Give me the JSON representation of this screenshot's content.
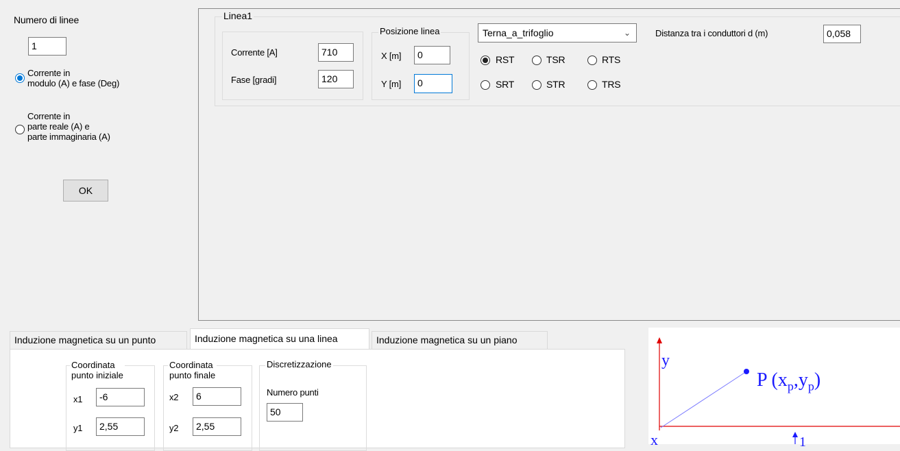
{
  "left_panel": {
    "num_lines_label": "Numero di linee",
    "num_lines_value": "1",
    "option_polar_label_1": "Corrente in",
    "option_polar_label_2": "modulo (A) e fase (Deg)",
    "option_rect_label_1": "Corrente in",
    "option_rect_label_2": "parte reale (A) e",
    "option_rect_label_3": "parte immaginaria (A)",
    "ok_label": "OK"
  },
  "line_group": {
    "title": "Linea1",
    "current_label": "Corrente [A]",
    "current_value": "710",
    "phase_label": "Fase [gradi]",
    "phase_value": "120",
    "position_title": "Posizione linea",
    "x_label": "X [m]",
    "x_value": "0",
    "y_label": "Y [m]",
    "y_value": "0",
    "configuration_selected": "Terna_a_trifoglio",
    "sequence_options": [
      "RST",
      "TSR",
      "RTS",
      "SRT",
      "STR",
      "TRS"
    ],
    "sequence_selected": "RST",
    "distance_label": "Distanza tra i conduttori d (m)",
    "distance_value": "0,058"
  },
  "tabs": [
    {
      "label": "Induzione magnetica su un punto",
      "active": false
    },
    {
      "label": "Induzione magnetica su una linea",
      "active": true
    },
    {
      "label": "Induzione magnetica su un piano",
      "active": false
    }
  ],
  "tab_content": {
    "start_title_1": "Coordinata",
    "start_title_2": "punto iniziale",
    "x1_label": "x1",
    "x1_value": "-6",
    "y1_label": "y1",
    "y1_value": "2,55",
    "end_title_1": "Coordinata",
    "end_title_2": "punto finale",
    "x2_label": "x2",
    "x2_value": "6",
    "y2_label": "y2",
    "y2_value": "2,55",
    "discretization_title": "Discretizzazione",
    "num_points_label": "Numero punti",
    "num_points_value": "50"
  },
  "diagram": {
    "axis_y": "y",
    "axis_x": "x",
    "point_label": "P (x",
    "point_sub_x": "p",
    "point_sep": ",y",
    "point_sub_y": "p",
    "point_close": ")",
    "partial_digit": "1",
    "colors": {
      "axis": "#e00000",
      "line": "#7b7bff",
      "point": "#1a1aff",
      "text": "#1a1aff"
    }
  }
}
